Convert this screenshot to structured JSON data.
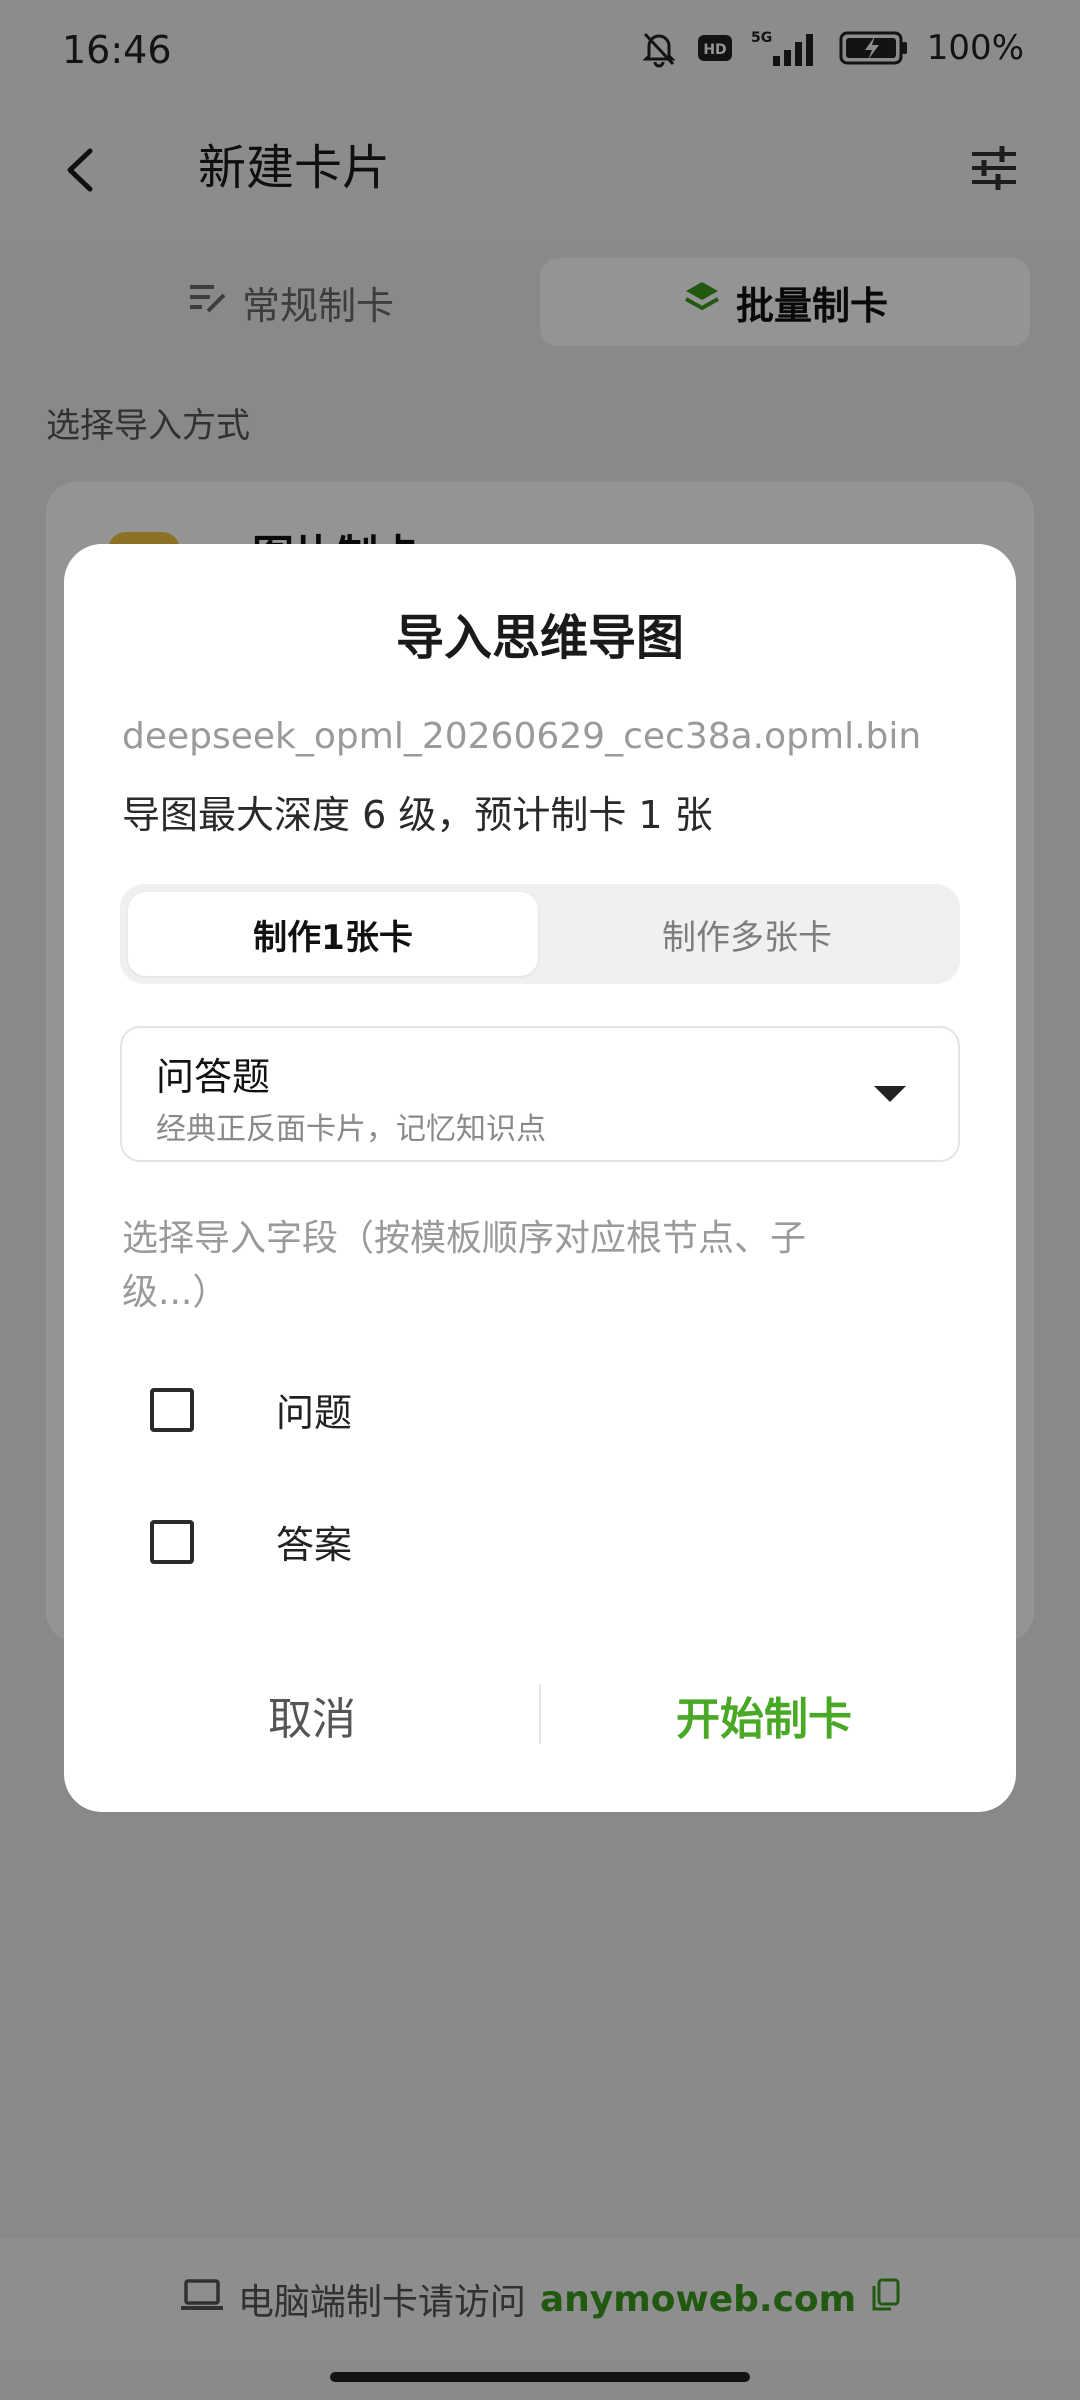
{
  "status_bar": {
    "time": "16:46",
    "battery_percent": "100%",
    "icons": [
      "muted-bell-icon",
      "hd-icon",
      "5g-signal-icon",
      "battery-charging-icon"
    ]
  },
  "header": {
    "title": "新建卡片",
    "back_icon": "chevron-left-icon",
    "settings_icon": "sliders-icon"
  },
  "mode_tabs": [
    {
      "label": "常规制卡",
      "icon": "edit-list-icon",
      "active": false
    },
    {
      "label": "批量制卡",
      "icon": "layers-icon",
      "active": true
    }
  ],
  "section_label": "选择导入方式",
  "background_card": {
    "title": "图片制卡"
  },
  "dialog": {
    "title": "导入思维导图",
    "file_name": "deepseek_opml_20260629_cec38a.opml.bin",
    "file_info": "导图最大深度 6 级，预计制卡 1 张",
    "count_tabs": [
      {
        "label": "制作1张卡",
        "active": true
      },
      {
        "label": "制作多张卡",
        "active": false
      }
    ],
    "template": {
      "name": "问答题",
      "description": "经典正反面卡片，记忆知识点"
    },
    "field_instructions": "选择导入字段（按模板顺序对应根节点、子级...）",
    "fields": [
      {
        "label": "问题",
        "checked": false
      },
      {
        "label": "答案",
        "checked": false
      }
    ],
    "cancel_label": "取消",
    "start_label": "开始制卡"
  },
  "bottom_bar": {
    "text": "电脑端制卡请访问",
    "link": "anymoweb.com"
  },
  "colors": {
    "accent_green": "#49a826",
    "link_green": "#3a9a1e"
  }
}
